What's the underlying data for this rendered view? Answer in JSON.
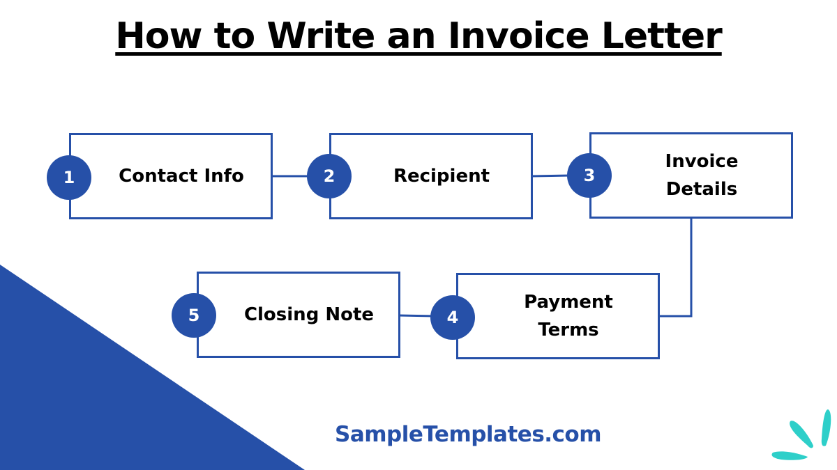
{
  "title": "How to Write an Invoice Letter",
  "steps": [
    {
      "number": "1",
      "label": "Contact Info"
    },
    {
      "number": "2",
      "label": "Recipient"
    },
    {
      "number": "3",
      "label": "Invoice\nDetails"
    },
    {
      "number": "4",
      "label": "Payment\nTerms"
    },
    {
      "number": "5",
      "label": "Closing Note"
    }
  ],
  "brand": "SampleTemplates.com",
  "colors": {
    "accent": "#2650a8",
    "logo": "#2ecfc9",
    "text": "#000000"
  }
}
